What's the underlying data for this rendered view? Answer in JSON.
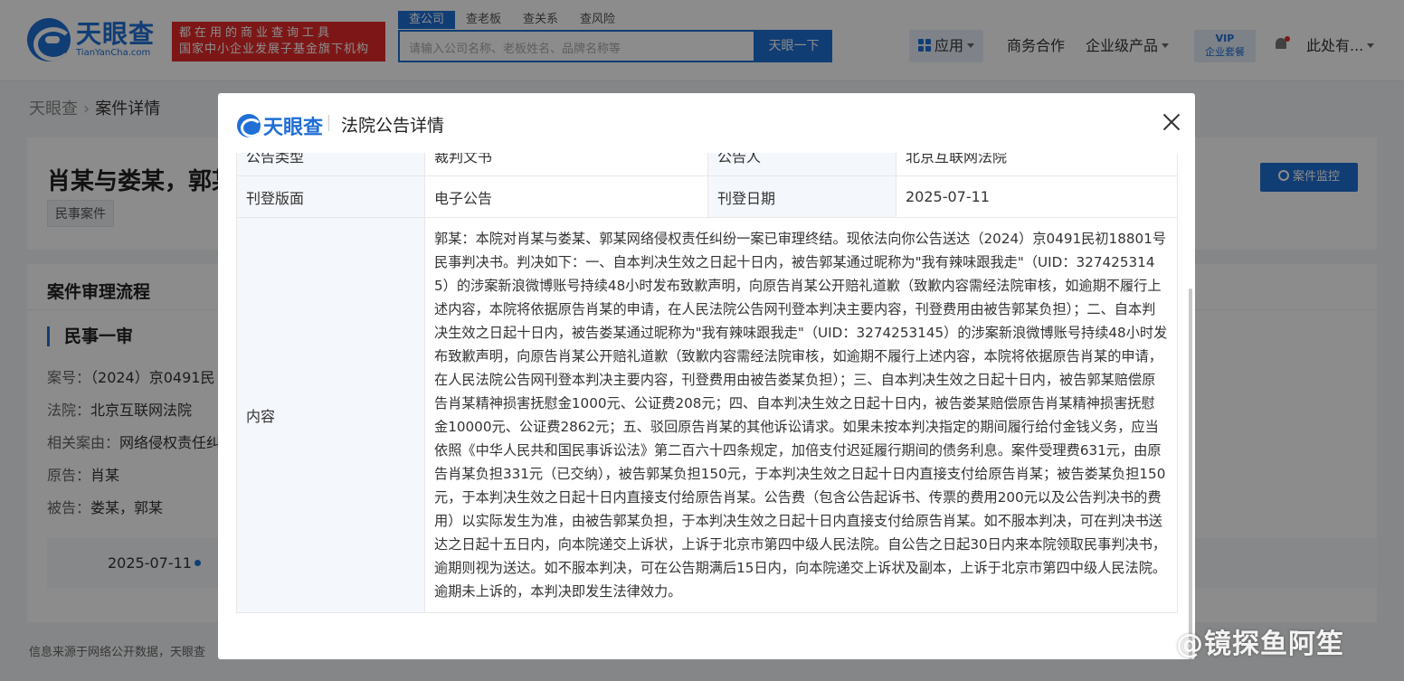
{
  "header": {
    "logo_main": "天眼查",
    "logo_sub": "TianYanCha.com",
    "slogan_line1": "都在用的商业查询工具",
    "slogan_line2": "国家中小企业发展子基金旗下机构",
    "search_tabs": [
      "查公司",
      "查老板",
      "查关系",
      "查风险"
    ],
    "search_placeholder": "请输入公司名称、老板姓名、品牌名称等",
    "search_button": "天眼一下",
    "nav_app": "应用",
    "nav_business": "商务合作",
    "nav_enterprise": "企业级产品",
    "vip_line1": "VIP",
    "vip_line2": "企业套餐",
    "user_name": "此处有..."
  },
  "breadcrumb": {
    "home": "天眼查",
    "current": "案件详情"
  },
  "case": {
    "title": "肖某与娄某，郭某",
    "tag": "民事案件",
    "monitor_button": "案件监控"
  },
  "flow": {
    "title": "案件审理流程",
    "stage": "民事一审",
    "rows": [
      {
        "label": "案号：",
        "value": "（2024）京0491民"
      },
      {
        "label": "法院：",
        "value": "北京互联网法院"
      },
      {
        "label": "相关案由：",
        "value": "网络侵权责任纠"
      },
      {
        "label": "原告：",
        "value": "肖某"
      },
      {
        "label": "被告：",
        "value": "娄某，郭某"
      }
    ],
    "timeline_date": "2025-07-11"
  },
  "footer_note": "信息来源于网络公开数据，天眼查",
  "modal": {
    "logo": "天眼查",
    "title": "法院公告详情",
    "rows": {
      "type_label": "公告类型",
      "type_value": "裁判文书",
      "announcer_label": "公告人",
      "announcer_value": "北京互联网法院",
      "layout_label": "刊登版面",
      "layout_value": "电子公告",
      "date_label": "刊登日期",
      "date_value": "2025-07-11",
      "content_label": "内容",
      "content_value": "郭某：本院对肖某与娄某、郭某网络侵权责任纠纷一案已审理终结。现依法向你公告送达（2024）京0491民初18801号民事判决书。判决如下：一、自本判决生效之日起十日内，被告郭某通过昵称为\"我有辣味跟我走\"（UID：3274253145）的涉案新浪微博账号持续48小时发布致歉声明，向原告肖某公开赔礼道歉（致歉内容需经法院审核，如逾期不履行上述内容，本院将依据原告肖某的申请，在人民法院公告网刊登本判决主要内容，刊登费用由被告郭某负担）；二、自本判决生效之日起十日内，被告娄某通过昵称为\"我有辣味跟我走\"（UID：3274253145）的涉案新浪微博账号持续48小时发布致歉声明，向原告肖某公开赔礼道歉（致歉内容需经法院审核，如逾期不履行上述内容，本院将依据原告肖某的申请，在人民法院公告网刊登本判决主要内容，刊登费用由被告娄某负担）；三、自本判决生效之日起十日内，被告郭某赔偿原告肖某精神损害抚慰金1000元、公证费208元；四、自本判决生效之日起十日内，被告娄某赔偿原告肖某精神损害抚慰金10000元、公证费2862元；五、驳回原告肖某的其他诉讼请求。如果未按本判决指定的期间履行给付金钱义务，应当依照《中华人民共和国民事诉讼法》第二百六十四条规定，加倍支付迟延履行期间的债务利息。案件受理费631元，由原告肖某负担331元（已交纳），被告郭某负担150元，于本判决生效之日起十日内直接支付给原告肖某；被告娄某负担150元，于本判决生效之日起十日内直接支付给原告肖某。公告费（包含公告起诉书、传票的费用200元以及公告判决书的费用）以实际发生为准，由被告郭某负担，于本判决生效之日起十日内直接支付给原告肖某。如不服本判决，可在判决书送达之日起十五日内，向本院递交上诉状，上诉于北京市第四中级人民法院。自公告之日起30日内来本院领取民事判决书，逾期则视为送达。如不服本判决，可在公告期满后15日内，向本院递交上诉状及副本，上诉于北京市第四中级人民法院。逾期未上诉的，本判决即发生法律效力。"
    }
  },
  "watermark": "@镜探鱼阿笙",
  "colors": {
    "brand": "#1f6fd6",
    "slogan_bg": "#e32b2b"
  }
}
